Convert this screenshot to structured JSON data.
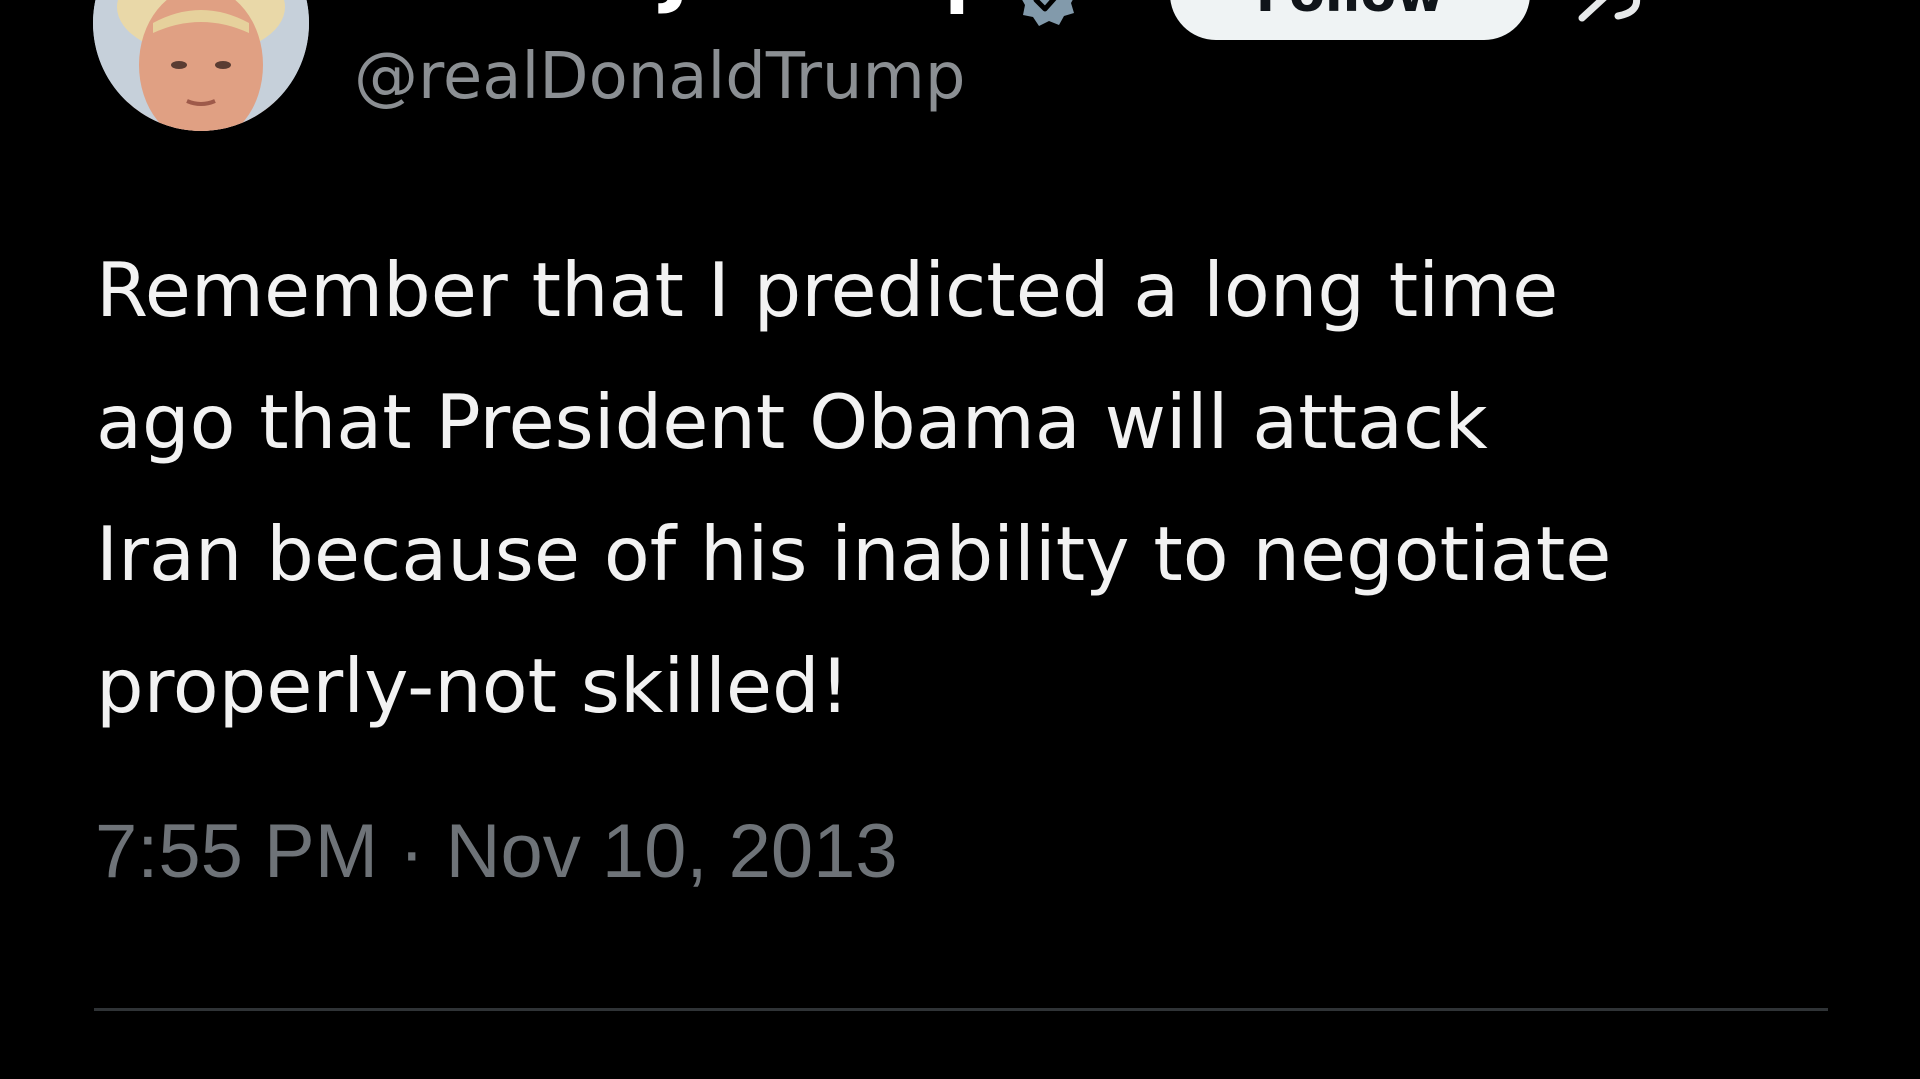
{
  "author": {
    "display_name": "Donald J. Trump",
    "handle": "@realDonaldTrump",
    "avatar_icon": "profile-photo",
    "verified_icon": "verified-badge-icon",
    "verified_color": "#829aab"
  },
  "actions": {
    "follow_label": "Follow",
    "grok_icon": "grok-icon"
  },
  "tweet": {
    "lines": [
      "Remember that I predicted a long time",
      "ago that President Obama will attack",
      "Iran because of his inability to negotiate",
      "properly-not skilled!"
    ],
    "timestamp": "7:55 PM · Nov 10, 2013"
  },
  "colors": {
    "background": "#000000",
    "text": "#f2f2f2",
    "secondary_text": "#8b8f93",
    "divider": "#2f3336",
    "button_bg": "#eff3f4"
  }
}
